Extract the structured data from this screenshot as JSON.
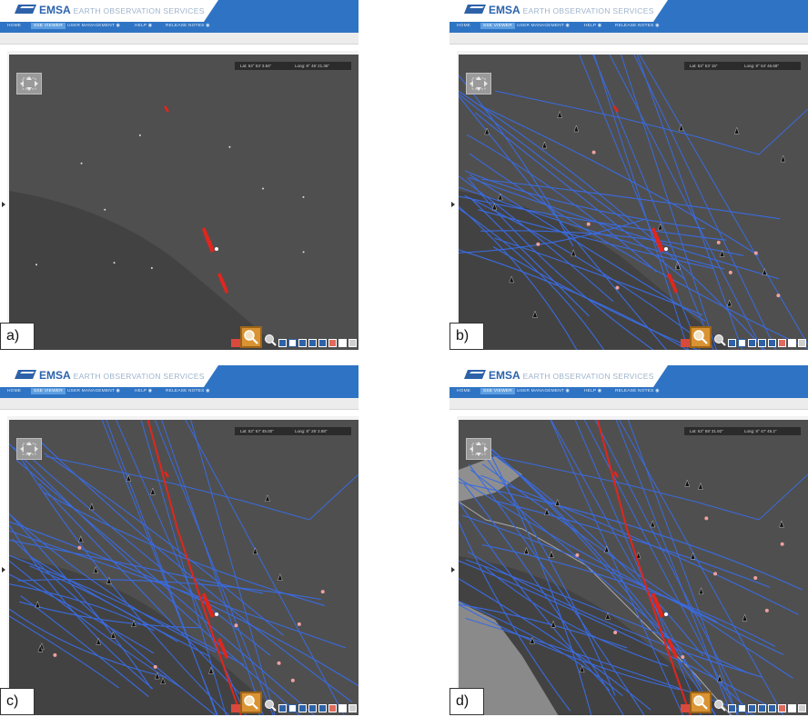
{
  "brand": {
    "logo_text": "EMSA",
    "service_title": "EARTH OBSERVATION SERVICES"
  },
  "nav": [
    {
      "label": "HOME"
    },
    {
      "label": "SSE VIEWER",
      "active": true
    },
    {
      "label": "USER MANAGEMENT"
    },
    {
      "label": "HELP"
    },
    {
      "label": "RELEASE NOTES"
    }
  ],
  "panels": [
    {
      "id": "a",
      "label": "a)",
      "lat": "Lat: 53° 53' 3.84\"",
      "long": "Long: 8° 46' 21.36\"",
      "tracks": false,
      "red_track": false,
      "land": false
    },
    {
      "id": "b",
      "label": "b)",
      "lat": "Lat: 53° 53' 15\"",
      "long": "Long: 8° 54' 46.68\"",
      "tracks": true,
      "red_track": false,
      "land": false
    },
    {
      "id": "c",
      "label": "c)",
      "lat": "Lat: 53° 57' 45.00\"",
      "long": "Long: 8° 26' 2.88\"",
      "tracks": true,
      "red_track": true,
      "land": false
    },
    {
      "id": "d",
      "label": "d)",
      "lat": "Lat: 53° 58' 31.92\"",
      "long": "Long: 8° 47' 45.2\"",
      "tracks": true,
      "red_track": true,
      "land": true
    }
  ],
  "colors": {
    "nav_blue": "#2f74c4",
    "track_blue": "#3a6be0",
    "spill_red": "#e0261e",
    "sea": "#4f4f4f"
  },
  "icons": [
    "emsa-logo-icon",
    "pan-control-icon",
    "zoom-icon",
    "toolbar-icon",
    "vessel-icon",
    "side-arrow-icon"
  ]
}
